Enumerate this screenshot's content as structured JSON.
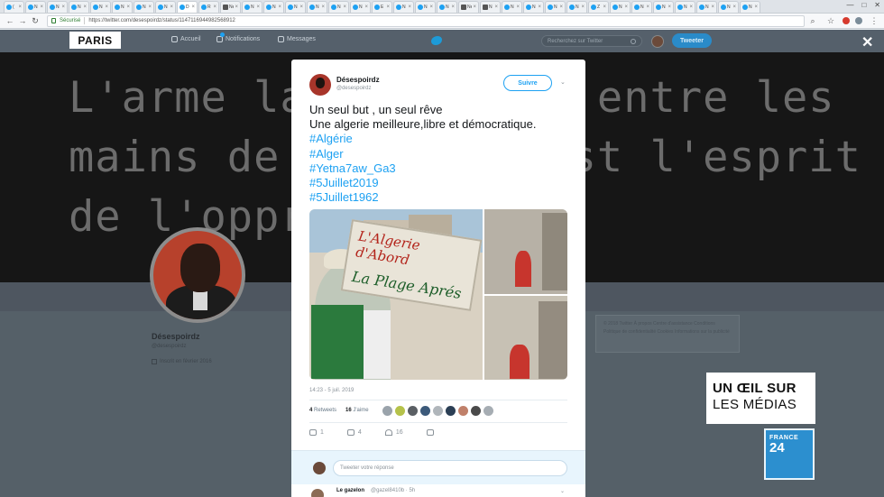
{
  "browser": {
    "tabs": [
      {
        "label": "(",
        "icon": "twitter-icon",
        "active": false
      },
      {
        "label": "N",
        "icon": "twitter-icon",
        "active": false
      },
      {
        "label": "N",
        "icon": "twitter-icon",
        "active": false
      },
      {
        "label": "N",
        "icon": "twitter-icon",
        "active": false
      },
      {
        "label": "N",
        "icon": "twitter-icon",
        "active": false
      },
      {
        "label": "N",
        "icon": "twitter-icon",
        "active": false
      },
      {
        "label": "N",
        "icon": "twitter-icon",
        "active": false
      },
      {
        "label": "N",
        "icon": "twitter-icon",
        "active": false
      },
      {
        "label": "D",
        "icon": "twitter-icon",
        "active": true
      },
      {
        "label": "R",
        "icon": "twitter-icon",
        "active": false
      },
      {
        "label": "Nes",
        "icon": "page-icon",
        "active": false
      },
      {
        "label": "N",
        "icon": "twitter-icon",
        "active": false
      },
      {
        "label": "N",
        "icon": "twitter-icon",
        "active": false
      },
      {
        "label": "N",
        "icon": "twitter-icon",
        "active": false
      },
      {
        "label": "N",
        "icon": "twitter-icon",
        "active": false
      },
      {
        "label": "N",
        "icon": "twitter-icon",
        "active": false
      },
      {
        "label": "N",
        "icon": "twitter-icon",
        "active": false
      },
      {
        "label": "E",
        "icon": "twitter-icon",
        "active": false
      },
      {
        "label": "N",
        "icon": "twitter-icon",
        "active": false
      },
      {
        "label": "N",
        "icon": "twitter-icon",
        "active": false
      },
      {
        "label": "N",
        "icon": "twitter-icon",
        "active": false
      },
      {
        "label": "Nes",
        "icon": "page-icon",
        "active": false
      },
      {
        "label": "N",
        "icon": "page-icon",
        "active": false
      },
      {
        "label": "N",
        "icon": "twitter-icon",
        "active": false
      },
      {
        "label": "N",
        "icon": "twitter-icon",
        "active": false
      },
      {
        "label": "N",
        "icon": "twitter-icon",
        "active": false
      },
      {
        "label": "N",
        "icon": "twitter-icon",
        "active": false
      },
      {
        "label": "Z",
        "icon": "twitter-icon",
        "active": false
      },
      {
        "label": "N",
        "icon": "twitter-icon",
        "active": false
      },
      {
        "label": "N",
        "icon": "twitter-icon",
        "active": false
      },
      {
        "label": "N",
        "icon": "twitter-icon",
        "active": false
      },
      {
        "label": "N",
        "icon": "twitter-icon",
        "active": false
      },
      {
        "label": "N",
        "icon": "twitter-icon",
        "active": false
      },
      {
        "label": "N",
        "icon": "twitter-icon",
        "active": false
      },
      {
        "label": "N",
        "icon": "twitter-icon",
        "active": false
      }
    ],
    "secure_label": "Sécurisé",
    "url": "https://twitter.com/desespoirdz/status/1147116944982568912",
    "window_controls": [
      "—",
      "□",
      "✕"
    ]
  },
  "twitter_header": {
    "nav": [
      {
        "label": "Accueil",
        "icon": "home-icon"
      },
      {
        "label": "Notifications",
        "icon": "bell-icon"
      },
      {
        "label": "Messages",
        "icon": "envelope-icon"
      }
    ],
    "search_placeholder": "Recherchez sur Twitter",
    "tweet_button": "Tweeter"
  },
  "profile": {
    "banner_text": "L'arme la p         entre les\nmains de l'        st l'esprit\nde l'opprim",
    "name": "Désespoirdz",
    "handle": "@desespoirdz",
    "joined": "Inscrit en février 2016",
    "footer_text": "© 2018 Twitter  À propos  Centre d'assistance Conditions  Politique de confidentialité  Cookies  Informations sur la publicité"
  },
  "overlays": {
    "paris_logo": "PARIS",
    "close": "✕",
    "show_logo_line1": "UN ŒIL SUR",
    "show_logo_line2": "LES MÉDIAS",
    "channel_logo_line1": "FRANCE",
    "channel_logo_line2": "24"
  },
  "tweet": {
    "author_name": "Désespoirdz",
    "author_handle": "@desespoirdz",
    "follow_label": "Suivre",
    "text_lines": [
      {
        "text": "Un seul but , un seul rêve",
        "hashtag": false
      },
      {
        "text": "Une algerie meilleure,libre et démocratique.",
        "hashtag": false
      },
      {
        "text": "#Algérie",
        "hashtag": true
      },
      {
        "text": "#Alger",
        "hashtag": true
      },
      {
        "text": "#Yetna7aw_Ga3",
        "hashtag": true
      },
      {
        "text": "#5Juillet2019",
        "hashtag": true
      },
      {
        "text": "#5Juillet1962",
        "hashtag": true
      }
    ],
    "photo_sign_line1": "L'Algerie d'Abord",
    "photo_sign_line2": "La Plage Aprés",
    "timestamp": "14:23 - 5 juil. 2019",
    "retweets_count": "4",
    "retweets_label": "Retweets",
    "likes_count": "16",
    "likes_label": "J'aime",
    "liker_colors": [
      "#9aa3ab",
      "#b5c24a",
      "#5a5f64",
      "#3c5a7a",
      "#b0b6bb",
      "#2b3f55",
      "#c0806a",
      "#4a4a4a",
      "#a6adb3"
    ],
    "actions": [
      {
        "icon": "reply-icon",
        "count": "1"
      },
      {
        "icon": "retweet-icon",
        "count": "4"
      },
      {
        "icon": "like-icon",
        "count": "16"
      },
      {
        "icon": "message-icon",
        "count": ""
      }
    ],
    "reply_placeholder": "Tweeter votre réponse",
    "next_reply_name": "Le gazelon",
    "next_reply_handle": "@gazel8410b · 5h"
  }
}
